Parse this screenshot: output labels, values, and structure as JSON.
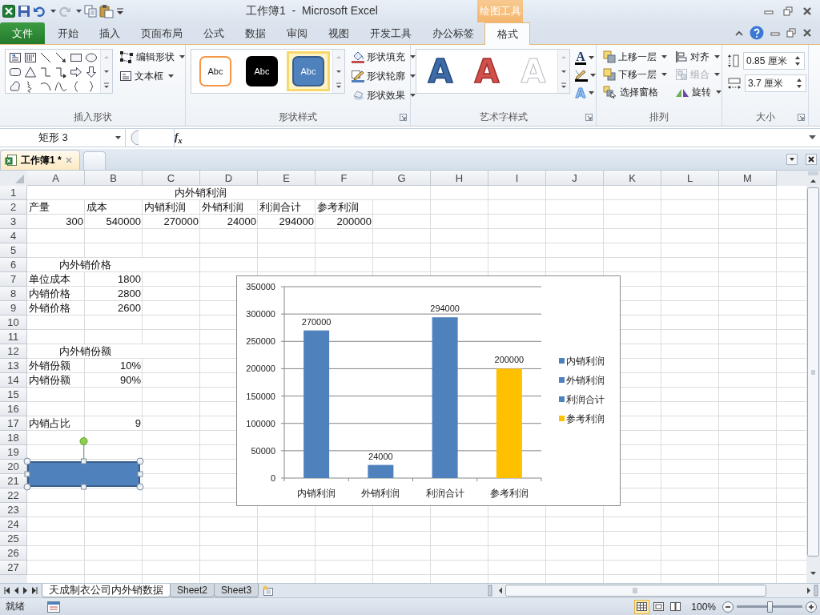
{
  "window": {
    "title": "工作簿1  -  Microsoft Excel",
    "context_label": "绘图工具"
  },
  "ribbon_tabs": [
    {
      "label": "文件",
      "kind": "file",
      "selected": false
    },
    {
      "label": "开始",
      "kind": "tab",
      "selected": false
    },
    {
      "label": "插入",
      "kind": "tab",
      "selected": false
    },
    {
      "label": "页面布局",
      "kind": "tab",
      "selected": false
    },
    {
      "label": "公式",
      "kind": "tab",
      "selected": false
    },
    {
      "label": "数据",
      "kind": "tab",
      "selected": false
    },
    {
      "label": "审阅",
      "kind": "tab",
      "selected": false
    },
    {
      "label": "视图",
      "kind": "tab",
      "selected": false
    },
    {
      "label": "开发工具",
      "kind": "tab",
      "selected": false
    },
    {
      "label": "办公标签",
      "kind": "tab",
      "selected": false
    },
    {
      "label": "格式",
      "kind": "context",
      "selected": true
    }
  ],
  "ribbon_groups": [
    {
      "kind": "insert_shapes",
      "label": "插入形状",
      "buttons": [
        {
          "label": "编辑形状",
          "kind": "edit_shape",
          "dropdown": true
        },
        {
          "label": "文本框",
          "kind": "textbox",
          "dropdown": true
        }
      ]
    },
    {
      "kind": "shape_styles",
      "label": "形状样式",
      "launcher": true,
      "presets": [
        {
          "text": "Abc",
          "kind": "outline",
          "selected": false
        },
        {
          "text": "Abc",
          "kind": "dark",
          "selected": false
        },
        {
          "text": "Abc",
          "kind": "filled",
          "selected": true
        }
      ],
      "buttons": [
        {
          "label": "形状填充",
          "kind": "fill",
          "dropdown": true
        },
        {
          "label": "形状轮廓",
          "kind": "outline",
          "dropdown": true
        },
        {
          "label": "形状效果",
          "kind": "effects",
          "dropdown": true
        }
      ]
    },
    {
      "kind": "wordart_styles",
      "label": "艺术字样式",
      "launcher": true,
      "presets": [
        {
          "text": "A",
          "kind": "blue"
        },
        {
          "text": "A",
          "kind": "red"
        },
        {
          "text": "A",
          "kind": "white"
        }
      ],
      "tools": [
        {
          "text": "A",
          "kind": "text_fill"
        },
        {
          "kind": "text_outline"
        },
        {
          "text": "A",
          "kind": "text_effects"
        }
      ]
    },
    {
      "kind": "arrange",
      "label": "排列",
      "buttons": [
        {
          "label": "上移一层",
          "kind": "bring_forward",
          "dropdown": true,
          "disabled": false
        },
        {
          "label": "下移一层",
          "kind": "send_backward",
          "dropdown": true,
          "disabled": false
        },
        {
          "label": "选择窗格",
          "kind": "selection_pane",
          "dropdown": false,
          "disabled": false
        },
        {
          "label": "对齐",
          "kind": "align",
          "dropdown": true,
          "disabled": false
        },
        {
          "label": "组合",
          "kind": "group",
          "dropdown": true,
          "disabled": true
        },
        {
          "label": "旋转",
          "kind": "rotate",
          "dropdown": true,
          "disabled": false
        }
      ]
    },
    {
      "kind": "size",
      "label": "大小",
      "launcher": true,
      "fields": [
        {
          "kind": "height",
          "value": "0.85 厘米"
        },
        {
          "kind": "width",
          "value": "3.7 厘米"
        }
      ]
    }
  ],
  "formula_bar": {
    "name_box": "矩形 3",
    "function_label": "f$_{x}$"
  },
  "workbook_tabs": [
    {
      "label": "工作簿1 *",
      "selected": true
    }
  ],
  "sheet": {
    "columns": [
      "A",
      "B",
      "C",
      "D",
      "E",
      "F",
      "G",
      "H",
      "I",
      "J",
      "K",
      "L",
      "M"
    ],
    "rows": [
      {
        "number": "1",
        "cells": [
          {
            "text": "内外销利润",
            "kind": "heading"
          }
        ]
      },
      {
        "number": "2",
        "cells": [
          {
            "text": "产量",
            "kind": "text"
          },
          {
            "text": "成本",
            "kind": "text"
          },
          {
            "text": "内销利润",
            "kind": "text"
          },
          {
            "text": "外销利润",
            "kind": "text"
          },
          {
            "text": "利润合计",
            "kind": "text"
          },
          {
            "text": "参考利润",
            "kind": "text"
          }
        ]
      },
      {
        "number": "3",
        "cells": [
          {
            "text": "300",
            "kind": "number"
          },
          {
            "text": "540000",
            "kind": "number"
          },
          {
            "text": "270000",
            "kind": "number"
          },
          {
            "text": "24000",
            "kind": "number"
          },
          {
            "text": "294000",
            "kind": "number"
          },
          {
            "text": "200000",
            "kind": "number"
          }
        ]
      },
      {
        "number": "4"
      },
      {
        "number": "5"
      },
      {
        "number": "6",
        "cells": [
          {
            "text": "内外销价格",
            "kind": "heading"
          }
        ]
      },
      {
        "number": "7",
        "cells": [
          {
            "text": "单位成本",
            "kind": "text"
          },
          {
            "text": "1800",
            "kind": "number"
          }
        ]
      },
      {
        "number": "8",
        "cells": [
          {
            "text": "内销价格",
            "kind": "text"
          },
          {
            "text": "2800",
            "kind": "number"
          }
        ]
      },
      {
        "number": "9",
        "cells": [
          {
            "text": "外销价格",
            "kind": "text"
          },
          {
            "text": "2600",
            "kind": "number"
          }
        ]
      },
      {
        "number": "10"
      },
      {
        "number": "11"
      },
      {
        "number": "12",
        "cells": [
          {
            "text": "内外销份额",
            "kind": "heading"
          }
        ]
      },
      {
        "number": "13",
        "cells": [
          {
            "text": "外销份额",
            "kind": "text"
          },
          {
            "text": "10%",
            "kind": "number"
          }
        ]
      },
      {
        "number": "14",
        "cells": [
          {
            "text": "内销份额",
            "kind": "text"
          },
          {
            "text": "90%",
            "kind": "number"
          }
        ]
      },
      {
        "number": "15"
      },
      {
        "number": "16"
      },
      {
        "number": "17",
        "cells": [
          {
            "text": "内销占比",
            "kind": "text"
          },
          {
            "text": "9",
            "kind": "number"
          }
        ]
      },
      {
        "number": "18"
      },
      {
        "number": "19"
      },
      {
        "number": "20"
      },
      {
        "number": "21"
      },
      {
        "number": "22"
      },
      {
        "number": "23"
      },
      {
        "number": "24"
      },
      {
        "number": "25"
      },
      {
        "number": "26"
      },
      {
        "number": "27"
      }
    ]
  },
  "chart": {
    "legend": [
      {
        "label": "内销利润",
        "color": "#4f81bd"
      },
      {
        "label": "外销利润",
        "color": "#4f81bd"
      },
      {
        "label": "利润合计",
        "color": "#4f81bd"
      },
      {
        "label": "参考利润",
        "color": "#ffc000"
      }
    ],
    "chart_data": {
      "type": "bar",
      "categories": [
        "内销利润",
        "外销利润",
        "利润合计",
        "参考利润"
      ],
      "values": [
        270000,
        24000,
        294000,
        200000
      ],
      "ylim": [
        0,
        350000
      ],
      "yticks": [
        0,
        50000,
        100000,
        150000,
        200000,
        250000,
        300000,
        350000
      ],
      "grid": true,
      "value_labels": [
        "270000",
        "24000",
        "294000",
        "200000"
      ]
    }
  },
  "shape": {
    "kind": "rectangle",
    "selected": true
  },
  "sheet_tabs": [
    {
      "label": "天成制衣公司内外销数据",
      "selected": true
    },
    {
      "label": "Sheet2",
      "selected": false
    },
    {
      "label": "Sheet3",
      "selected": false
    }
  ],
  "status_bar": {
    "ready": "就绪",
    "views": [
      {
        "kind": "normal",
        "selected": true
      },
      {
        "kind": "page_layout",
        "selected": false
      },
      {
        "kind": "page_break",
        "selected": false
      }
    ],
    "zoom": "100%",
    "zoom_slider": {
      "level": 0.5
    }
  }
}
